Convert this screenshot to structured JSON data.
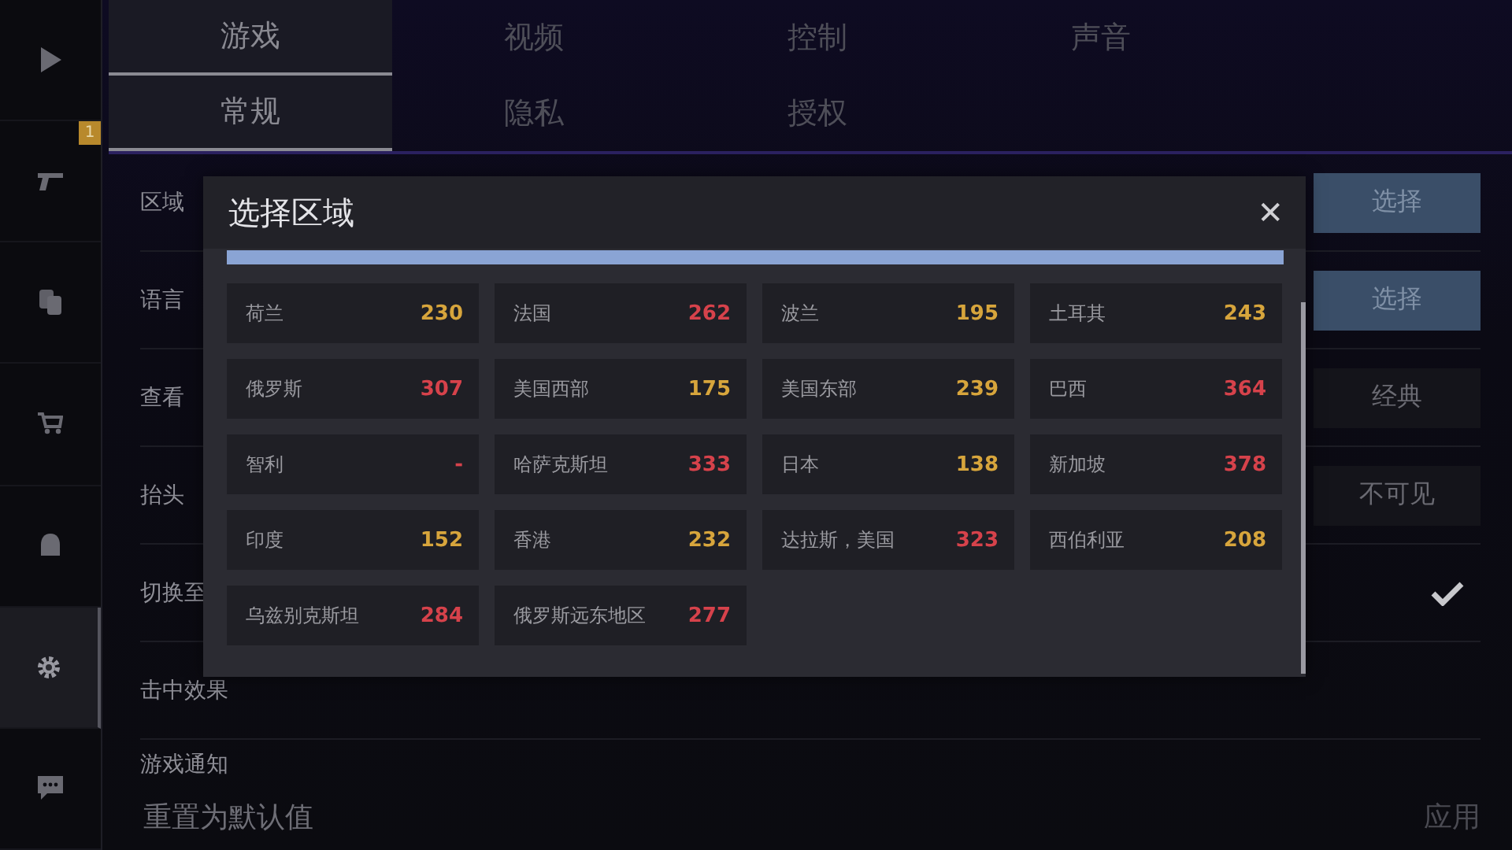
{
  "sidebar": {
    "items": [
      {
        "selected": false
      },
      {
        "selected": false,
        "badge": "1"
      },
      {
        "selected": false
      },
      {
        "selected": false
      },
      {
        "selected": false
      },
      {
        "selected": true
      },
      {
        "selected": false
      }
    ]
  },
  "tabs": [
    [
      {
        "label": "游戏",
        "selected": true
      },
      {
        "label": "视频",
        "selected": false
      },
      {
        "label": "控制",
        "selected": false
      },
      {
        "label": "声音",
        "selected": false
      }
    ],
    [
      {
        "label": "常规",
        "selected": true
      },
      {
        "label": "隐私",
        "selected": false
      },
      {
        "label": "授权",
        "selected": false
      }
    ]
  ],
  "settings": [
    {
      "label": "区域",
      "kind": "button",
      "value": "选择"
    },
    {
      "label": "语言",
      "kind": "button",
      "value": "选择"
    },
    {
      "label": "查看",
      "kind": "option",
      "value": "经典"
    },
    {
      "label": "抬头",
      "kind": "option",
      "value": "不可见"
    },
    {
      "label": "切换至",
      "kind": "toggle",
      "checked": true
    },
    {
      "label": "击中效果",
      "kind": "none"
    },
    {
      "label": "游戏通知",
      "kind": "none"
    }
  ],
  "footer": {
    "reset": "重置为默认值",
    "apply": "应用"
  },
  "dialog": {
    "title": "选择区域",
    "close": "✕",
    "regions": [
      {
        "name": "荷兰",
        "ping": "230",
        "color": "#d7a53c"
      },
      {
        "name": "法国",
        "ping": "262",
        "color": "#d6424b"
      },
      {
        "name": "波兰",
        "ping": "195",
        "color": "#d7a53c"
      },
      {
        "name": "土耳其",
        "ping": "243",
        "color": "#d7a53c"
      },
      {
        "name": "俄罗斯",
        "ping": "307",
        "color": "#d6424b"
      },
      {
        "name": "美国西部",
        "ping": "175",
        "color": "#d7a53c"
      },
      {
        "name": "美国东部",
        "ping": "239",
        "color": "#d7a53c"
      },
      {
        "name": "巴西",
        "ping": "364",
        "color": "#d6424b"
      },
      {
        "name": "智利",
        "ping": "-",
        "color": "#d6424b"
      },
      {
        "name": "哈萨克斯坦",
        "ping": "333",
        "color": "#d6424b"
      },
      {
        "name": "日本",
        "ping": "138",
        "color": "#d7a53c"
      },
      {
        "name": "新加坡",
        "ping": "378",
        "color": "#d6424b"
      },
      {
        "name": "印度",
        "ping": "152",
        "color": "#d7a53c"
      },
      {
        "name": "香港",
        "ping": "232",
        "color": "#d7a53c"
      },
      {
        "name": "达拉斯，美国",
        "ping": "323",
        "color": "#d6424b"
      },
      {
        "name": "西伯利亚",
        "ping": "208",
        "color": "#d7a53c"
      },
      {
        "name": "乌兹别克斯坦",
        "ping": "284",
        "color": "#d6424b"
      },
      {
        "name": "俄罗斯远东地区",
        "ping": "277",
        "color": "#d6424b"
      }
    ]
  }
}
